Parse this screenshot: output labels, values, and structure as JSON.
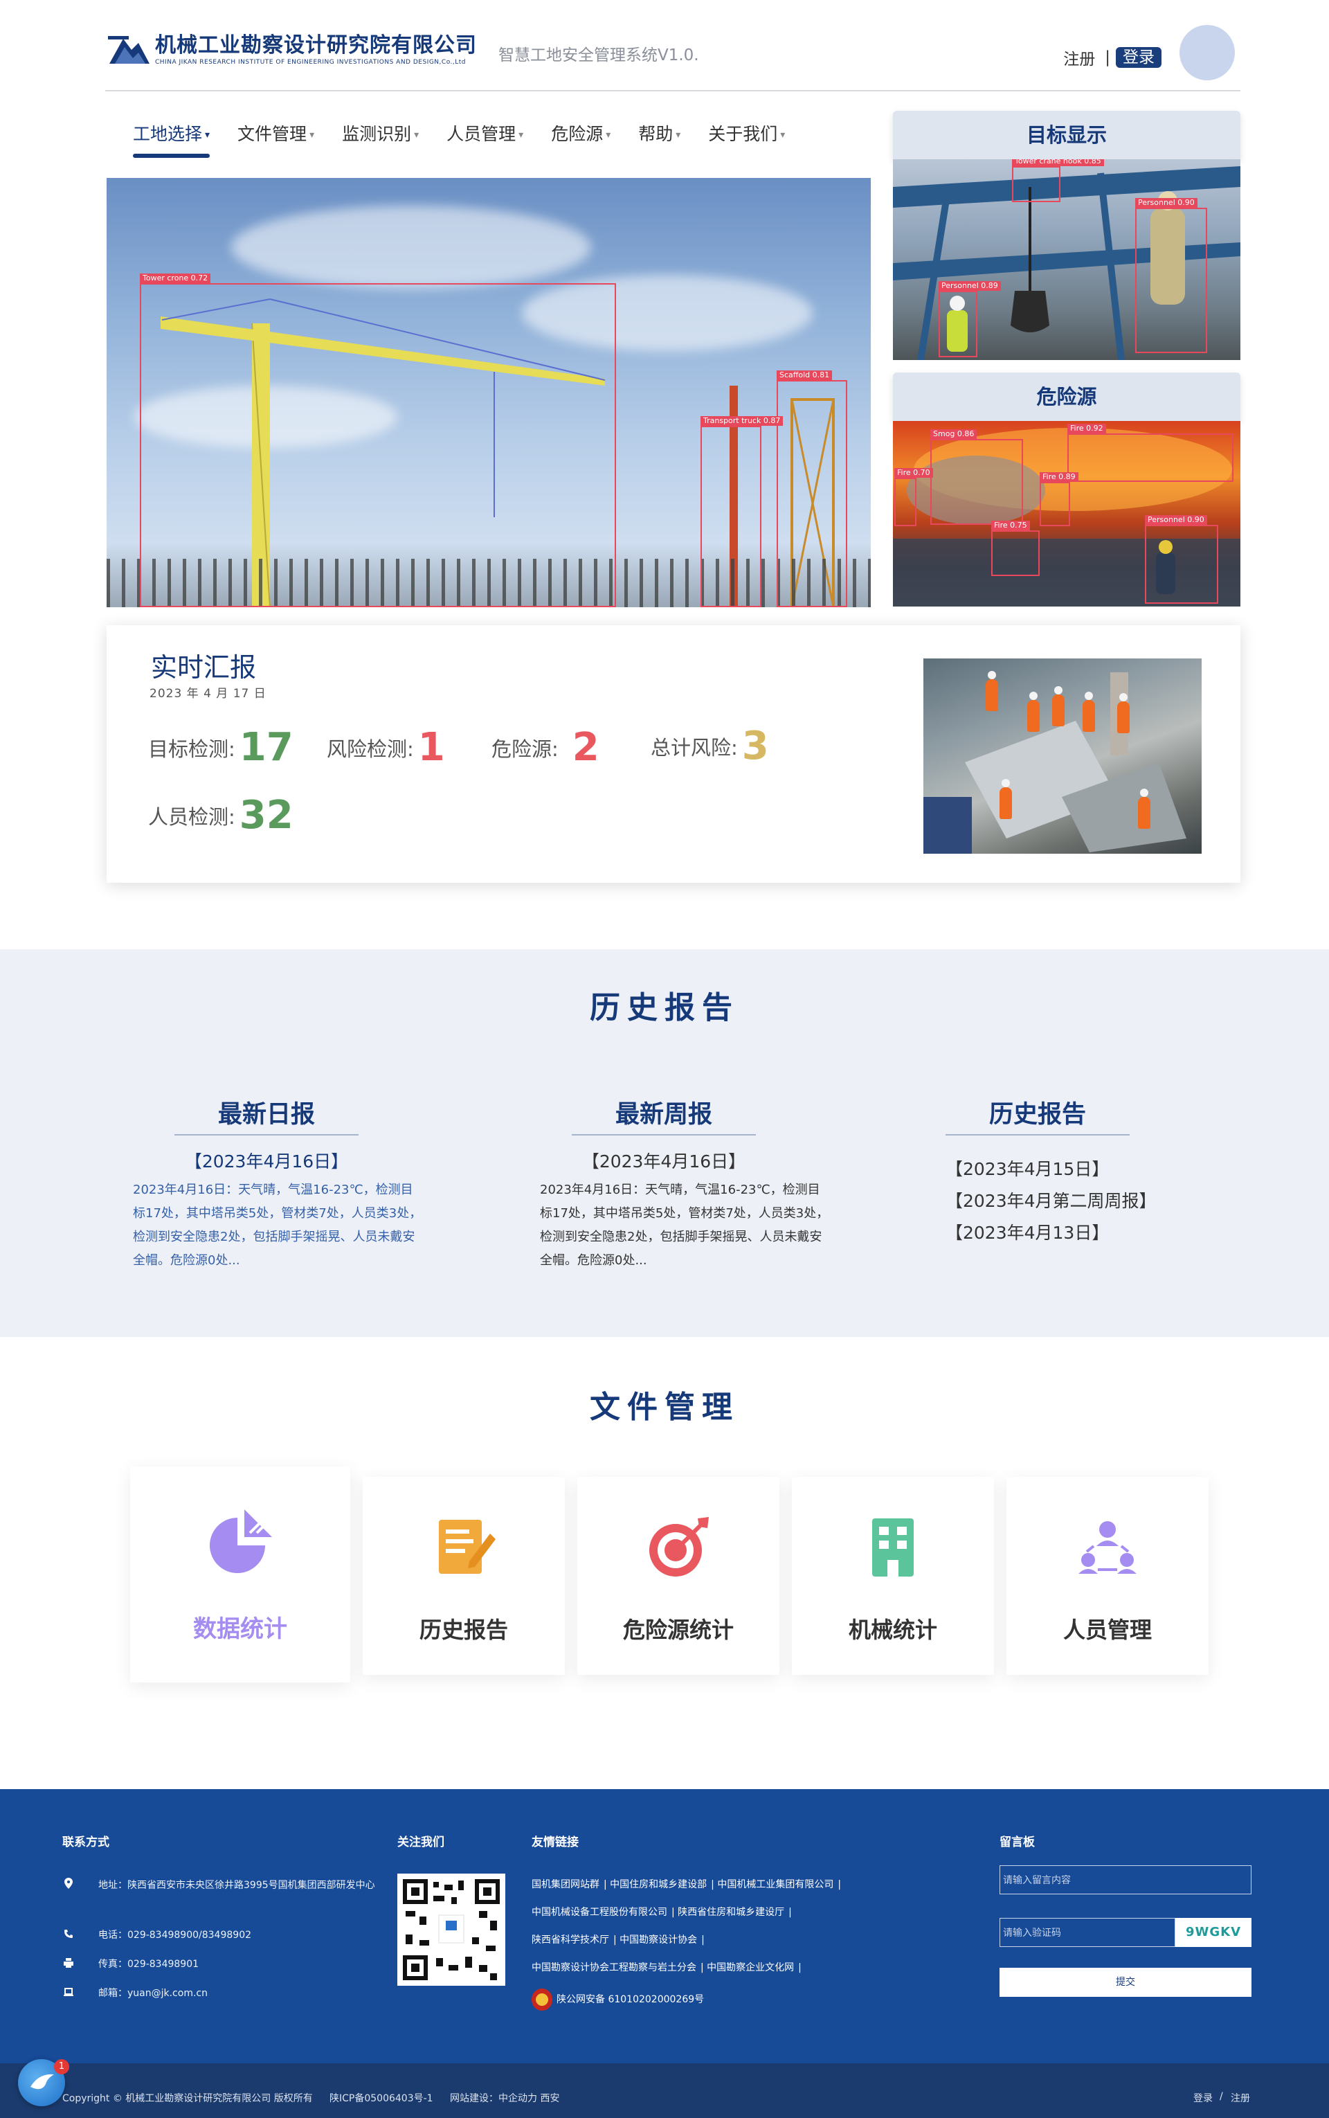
{
  "header": {
    "company_cn": "机械工业勘察设计研究院有限公司",
    "company_en": "CHINA JIKAN RESEARCH INSTITUTE OF ENGINEERING INVESTIGATIONS AND DESIGN,Co.,Ltd",
    "system_title": "智慧工地安全管理系统V1.0.",
    "register": "注册",
    "separator": "|",
    "login": "登录"
  },
  "nav": {
    "items": [
      {
        "label": "工地选择",
        "active": true
      },
      {
        "label": "文件管理"
      },
      {
        "label": "监测识别"
      },
      {
        "label": "人员管理"
      },
      {
        "label": "危险源"
      },
      {
        "label": "帮助"
      },
      {
        "label": "关于我们"
      }
    ],
    "caret": "▾"
  },
  "hero": {
    "detections": [
      {
        "label": "Tower crone  0.72"
      },
      {
        "label": "Scaffold  0.81"
      },
      {
        "label": "Transport truck  0.87"
      }
    ]
  },
  "target_panel": {
    "title": "目标显示",
    "detections": [
      {
        "label": "Tower crane hook  0.85"
      },
      {
        "label": "Personnel  0.90"
      },
      {
        "label": "Personnel  0.89"
      }
    ]
  },
  "hazard_panel": {
    "title": "危险源",
    "detections": [
      {
        "label": "Smog  0.86"
      },
      {
        "label": "Fire  0.92"
      },
      {
        "label": "Fire  0.70"
      },
      {
        "label": "Fire  0.89"
      },
      {
        "label": "Fire  0.75"
      },
      {
        "label": "Personnel  0.90"
      }
    ]
  },
  "report": {
    "title": "实时汇报",
    "date": "2023 年 4 月 17 日",
    "stats": [
      {
        "label": "目标检测:",
        "value": "17",
        "color": "#5a9a5c"
      },
      {
        "label": "风险检测:",
        "value": "1",
        "color": "#e9585f"
      },
      {
        "label": "危险源:",
        "value": "2",
        "color": "#e9585f"
      },
      {
        "label": "总计风险:",
        "value": "3",
        "color": "#d7b862"
      },
      {
        "label": "人员检测:",
        "value": "32",
        "color": "#5a9a5c"
      }
    ]
  },
  "history": {
    "title": "历史报告",
    "daily": {
      "heading": "最新日报",
      "date": "【2023年4月16日】",
      "body": "2023年4月16日：天气晴，气温16-23℃，检测目标17处，其中塔吊类5处，管材类7处，人员类3处，检测到安全隐患2处，包括脚手架摇晃、人员未戴安全帽。危险源0处..."
    },
    "weekly": {
      "heading": "最新周报",
      "date": "【2023年4月16日】",
      "body": "2023年4月16日：天气晴，气温16-23℃，检测目标17处，其中塔吊类5处，管材类7处，人员类3处，检测到安全隐患2处，包括脚手架摇晃、人员未戴安全帽。危险源0处..."
    },
    "archive": {
      "heading": "历史报告",
      "items": [
        "【2023年4月15日】",
        "【2023年4月第二周周报】",
        "【2023年4月13日】"
      ]
    }
  },
  "files": {
    "title": "文件管理",
    "cards": [
      {
        "label": "数据统计",
        "icon": "pie-chart-icon",
        "color": "#a48cf0"
      },
      {
        "label": "历史报告",
        "icon": "edit-document-icon",
        "color": "#f0a93a"
      },
      {
        "label": "危险源统计",
        "icon": "target-icon",
        "color": "#e9585f"
      },
      {
        "label": "机械统计",
        "icon": "building-icon",
        "color": "#5cc49a"
      },
      {
        "label": "人员管理",
        "icon": "team-icon",
        "color": "#a48cf0"
      }
    ]
  },
  "footer": {
    "contact_title": "联系方式",
    "address": "地址：陕西省西安市未央区徐井路3995号国机集团西部研发中心",
    "phone": "电话：029-83498900/83498902",
    "fax": "传真：029-83498901",
    "email": "邮箱：yuan@jk.com.cn",
    "follow_title": "关注我们",
    "links_title": "友情链接",
    "links": [
      [
        "国机集团网站群",
        "中国住房和城乡建设部",
        "中国机械工业集团有限公司"
      ],
      [
        "中国机械设备工程股份有限公司",
        "陕西省住房和城乡建设厅"
      ],
      [
        "陕西省科学技术厅",
        "中国勘察设计协会"
      ],
      [
        "中国勘察设计协会工程勘察与岩土分会",
        "中国勘察企业文化网"
      ]
    ],
    "police_record": "陕公网安备 61010202000269号",
    "message_title": "留言板",
    "message_placeholder": "请输入留言内容",
    "captcha_placeholder": "请输入验证码",
    "captcha_code": "9WGKV",
    "submit": "提交",
    "copyright": "Copyright © 机械工业勘察设计研究院有限公司 版权所有",
    "icp": "陕ICP备05006403号-1",
    "builder": "网站建设：中企动力 西安",
    "bottom_login": "登录",
    "bottom_sep": "/",
    "bottom_register": "注册"
  },
  "float_widget": {
    "badge": "1"
  }
}
